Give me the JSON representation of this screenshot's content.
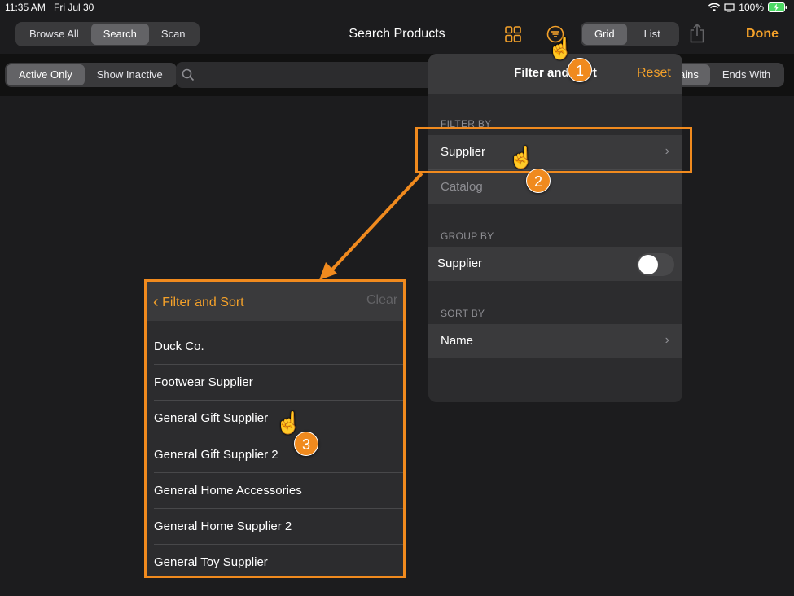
{
  "status_bar": {
    "time": "11:35 AM",
    "date": "Fri Jul 30",
    "battery": "100%"
  },
  "nav": {
    "mode_tabs": [
      {
        "label": "Browse All",
        "active": false
      },
      {
        "label": "Search",
        "active": true
      },
      {
        "label": "Scan",
        "active": false
      }
    ],
    "title": "Search Products",
    "view_tabs": [
      {
        "label": "Grid",
        "active": true
      },
      {
        "label": "List",
        "active": false
      }
    ],
    "done_label": "Done"
  },
  "toolbar": {
    "status_tabs": [
      {
        "label": "Active Only",
        "active": true
      },
      {
        "label": "Show Inactive",
        "active": false
      }
    ],
    "match_tabs": [
      {
        "label": "ains",
        "active": true
      },
      {
        "label": "Ends With",
        "active": false
      }
    ]
  },
  "filter_popover": {
    "title": "Filter and Sort",
    "reset_label": "Reset",
    "filter_by_label": "FILTER BY",
    "filter_rows": [
      "Supplier",
      "Catalog"
    ],
    "group_by_label": "GROUP BY",
    "group_row": "Supplier",
    "group_toggle_on": false,
    "sort_by_label": "SORT BY",
    "sort_row": "Name"
  },
  "supplier_panel": {
    "back_label": "Filter and Sort",
    "clear_label": "Clear",
    "items": [
      "Duck Co.",
      "Footwear Supplier",
      "General Gift Supplier",
      "General Gift Supplier 2",
      "General Home Accessories",
      "General Home Supplier 2",
      "General Toy Supplier"
    ]
  },
  "annotations": {
    "step1": "1",
    "step2": "2",
    "step3": "3"
  },
  "colors": {
    "accent": "#f4a12a",
    "callout": "#f08a1e"
  }
}
